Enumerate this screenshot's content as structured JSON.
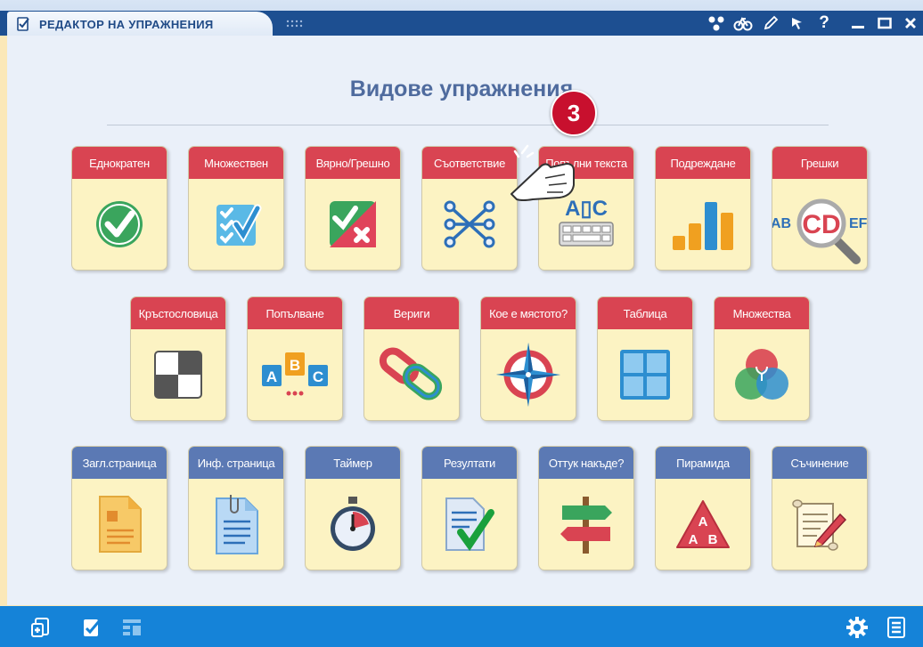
{
  "window": {
    "title": "РЕДАКТОР НА УПРАЖНЕНИЯ",
    "controls": [
      "network-icon",
      "bike-icon",
      "pencil-icon",
      "pointer-icon",
      "help-icon",
      "minimize-icon",
      "maximize-icon",
      "close-icon"
    ],
    "help_label": "?"
  },
  "main": {
    "heading": "Видове упражнения",
    "annotation": "3"
  },
  "tiles": [
    {
      "label": "Еднократен",
      "icon": "single-check-icon",
      "color": "red"
    },
    {
      "label": "Множествен",
      "icon": "multiple-choice-icon",
      "color": "red"
    },
    {
      "label": "Вярно/Грешно",
      "icon": "true-false-icon",
      "color": "red"
    },
    {
      "label": "Съответствие",
      "icon": "matching-icon",
      "color": "red"
    },
    {
      "label": "Попълни текста",
      "icon": "fill-text-icon",
      "color": "red",
      "icon_text": "A▯C"
    },
    {
      "label": "Подреждане",
      "icon": "ordering-bars-icon",
      "color": "red"
    },
    {
      "label": "Грешки",
      "icon": "mistakes-magnifier-icon",
      "color": "red",
      "icon_text": [
        "AB",
        "CD",
        "EF"
      ]
    },
    {
      "label": "Кръстословица",
      "icon": "crossword-icon",
      "color": "red"
    },
    {
      "label": "Попълване",
      "icon": "fill-in-icon",
      "color": "red",
      "icon_text": [
        "A",
        "B",
        "C"
      ]
    },
    {
      "label": "Вериги",
      "icon": "chain-icon",
      "color": "red"
    },
    {
      "label": "Кое е мястото?",
      "icon": "compass-icon",
      "color": "red"
    },
    {
      "label": "Таблица",
      "icon": "table-grid-icon",
      "color": "red"
    },
    {
      "label": "Множества",
      "icon": "sets-venn-icon",
      "color": "red"
    },
    {
      "label": "Загл.страница",
      "icon": "title-page-icon",
      "color": "blue"
    },
    {
      "label": "Инф. страница",
      "icon": "info-page-icon",
      "color": "blue"
    },
    {
      "label": "Таймер",
      "icon": "stopwatch-icon",
      "color": "blue"
    },
    {
      "label": "Резултати",
      "icon": "results-icon",
      "color": "blue"
    },
    {
      "label": "Оттук накъде?",
      "icon": "signpost-icon",
      "color": "blue"
    },
    {
      "label": "Пирамида",
      "icon": "pyramid-icon",
      "color": "blue",
      "icon_text": [
        "A",
        "A",
        "B"
      ]
    },
    {
      "label": "Съчинение",
      "icon": "essay-scroll-icon",
      "color": "blue"
    }
  ],
  "bottom": {
    "left": [
      "add-exercise-icon",
      "edit-exercise-icon",
      "layout-icon"
    ],
    "right": [
      "settings-icon",
      "list-icon"
    ]
  },
  "colors": {
    "red_header": "#d94452",
    "blue_header": "#5b79b4",
    "tile_bg": "#fcf3c3",
    "bottom_bar": "#1583d8",
    "title_bar": "#1d4f91"
  }
}
